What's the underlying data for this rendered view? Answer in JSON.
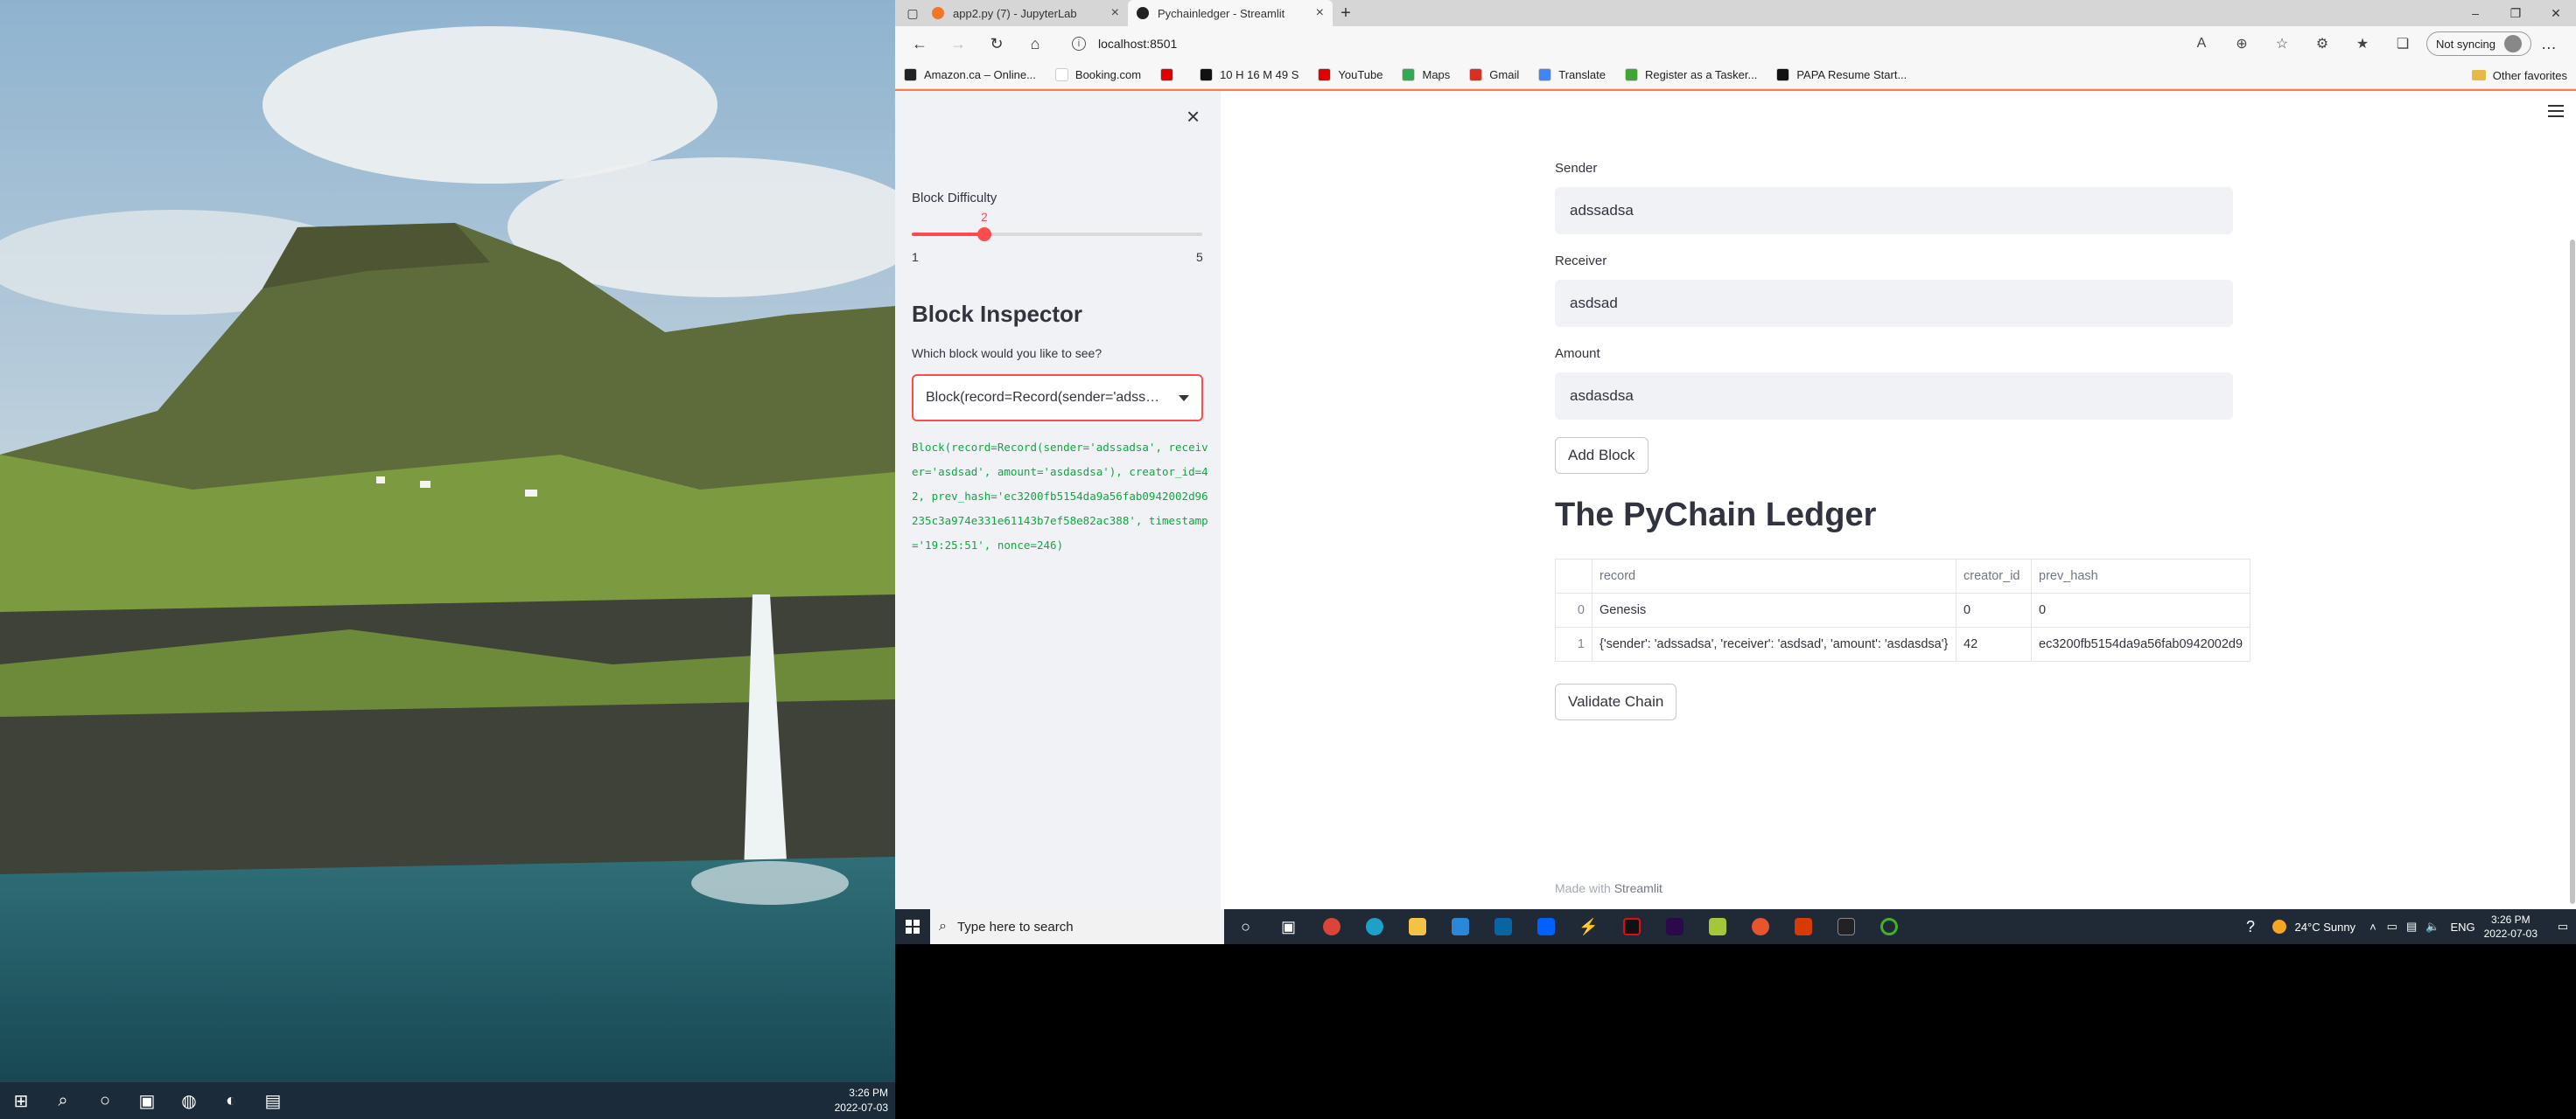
{
  "browser": {
    "tabs": [
      {
        "title": "app2.py (7) - JupyterLab",
        "favicon_color": "#f37626",
        "active": false
      },
      {
        "title": "Pychainledger - Streamlit",
        "favicon_color": "#222222",
        "active": true
      }
    ],
    "address": "localhost:8501",
    "sync_label": "Not syncing",
    "favorites": [
      {
        "label": "Amazon.ca – Online...",
        "color": "#222222"
      },
      {
        "label": "Booking.com",
        "color": "#ffffff"
      },
      {
        "label": "",
        "color": "#e00000"
      },
      {
        "label": "10 H 16 M 49 S",
        "color": "#111111"
      },
      {
        "label": "YouTube",
        "color": "#e00000"
      },
      {
        "label": "Maps",
        "color": "#34a853"
      },
      {
        "label": "Gmail",
        "color": "#d93025"
      },
      {
        "label": "Translate",
        "color": "#4285f4"
      },
      {
        "label": "Register as a Tasker...",
        "color": "#3fa535"
      },
      {
        "label": "PAPA Resume Start...",
        "color": "#111111"
      }
    ],
    "other_favorites": "Other favorites"
  },
  "sidebar": {
    "difficulty_label": "Block Difficulty",
    "difficulty_value": "2",
    "difficulty_min": "1",
    "difficulty_max": "5",
    "inspector_title": "Block Inspector",
    "select_label": "Which block would you like to see?",
    "select_value": "Block(record=Record(sender='adssadsa'",
    "block_detail": "Block(record=Record(sender='adssadsa', receiver='asdsad', amount='asdasdsa'), creator_id=42, prev_hash='ec3200fb5154da9a56fab0942002d96235c3a974e331e61143b7ef58e82ac388', timestamp='19:25:51', nonce=246)"
  },
  "form": {
    "sender_label": "Sender",
    "sender_value": "adssadsa",
    "receiver_label": "Receiver",
    "receiver_value": "asdsad",
    "amount_label": "Amount",
    "amount_value": "asdasdsa",
    "add_button": "Add Block"
  },
  "ledger": {
    "title": "The PyChain Ledger",
    "columns": [
      "",
      "record",
      "creator_id",
      "prev_hash"
    ],
    "rows": [
      {
        "index": "0",
        "record": "Genesis",
        "creator_id": "0",
        "prev_hash": "0"
      },
      {
        "index": "1",
        "record": "{'sender': 'adssadsa', 'receiver': 'asdsad', 'amount': 'asdasdsa'}",
        "creator_id": "42",
        "prev_hash": "ec3200fb5154da9a56fab0942002d9"
      }
    ],
    "validate_button": "Validate Chain"
  },
  "footer": {
    "prefix": "Made with",
    "brand": "Streamlit"
  },
  "taskbar": {
    "search_placeholder": "Type here to search",
    "weather": "24°C  Sunny",
    "language": "ENG",
    "time": "3:26 PM",
    "date": "2022-07-03"
  },
  "left_taskbar": {
    "time": "3:26 PM",
    "date": "2022-07-03"
  },
  "colors": {
    "accent": "#ff4b4b",
    "code_green": "#09ab3b",
    "sidebar_bg": "#f0f2f6"
  }
}
